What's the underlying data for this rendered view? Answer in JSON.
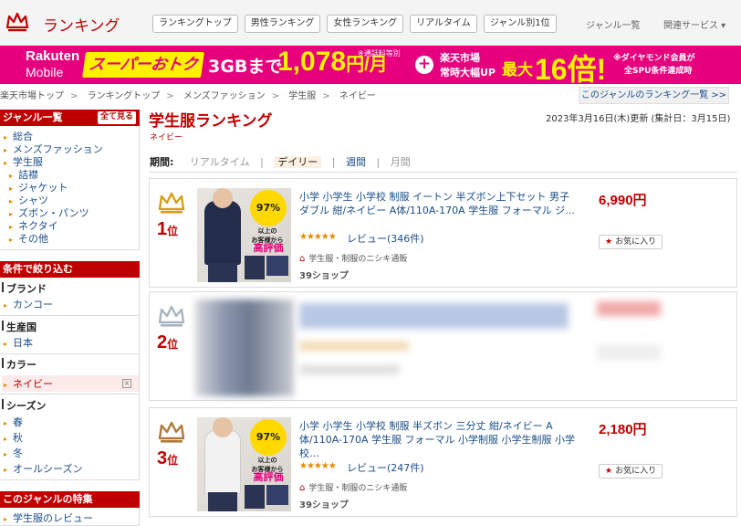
{
  "header": {
    "logo_text": "ランキング",
    "tabs": [
      "ランキングトップ",
      "男性ランキング",
      "女性ランキング",
      "リアルタイム",
      "ジャンル別1位"
    ],
    "genre_list_link": "ジャンル一覧",
    "related_services": "関連サービス ▾"
  },
  "banner": {
    "brand_top": "Rakuten",
    "brand_bottom": "Mobile",
    "sale": "スーパーおトク",
    "data_amount": "3GBまで",
    "note_call": "※通話料等別",
    "price": "1,078",
    "price_unit": "円/月",
    "ichiba_line1": "楽天市場",
    "ichiba_line2": "常時大幅UP",
    "max": "最大",
    "multiplier": "16倍!",
    "note_diamond": "※ダイヤモンド会員が",
    "note_spu": "全SPU条件達成時"
  },
  "breadcrumb": [
    "楽天市場トップ",
    "ランキングトップ",
    "メンズファッション",
    "学生服",
    "ネイビー"
  ],
  "genre_ranking_list_link": "このジャンルのランキング一覧 >>",
  "sidebar": {
    "genre_heading": "ジャンル一覧",
    "show_all": "全て見る",
    "genres": [
      "総合",
      "メンズファッション",
      "学生服",
      "詰襟",
      "ジャケット",
      "シャツ",
      "ズボン・パンツ",
      "ネクタイ",
      "その他"
    ],
    "filter_heading": "条件で絞り込む",
    "brand_label": "ブランド",
    "brand_value": "カンコー",
    "country_label": "生産国",
    "country_value": "日本",
    "color_label": "カラー",
    "color_value": "ネイビー",
    "season_label": "シーズン",
    "seasons": [
      "春",
      "秋",
      "冬",
      "オールシーズン"
    ],
    "feature_heading": "このジャンルの特集",
    "feature_item": "学生服のレビュー"
  },
  "main": {
    "title": "学生服ランキング",
    "subtitle": "ネイビー",
    "updated": "2023年3月16日(木)更新 (集計日：3月15日)",
    "period_label": "期間:",
    "periods": [
      "リアルタイム",
      "デイリー",
      "週間",
      "月間"
    ],
    "period_separators": [
      "|",
      "|",
      "|"
    ],
    "rank_suffix": "位"
  },
  "thumb_badge": {
    "pct": "97%",
    "line1": "以上の",
    "line2": "お客様から",
    "line3": "高評価"
  },
  "items": [
    {
      "rank": "1",
      "title": "小学 小学生 小学校 制服 イートン 半ズボン上下セット 男子 ダブル 紺/ネイビー A体/110A-170A 学生服 フォーマル ジ…",
      "stars": "★★★★★",
      "review": "レビュー(346件)",
      "shop_category": "学生服・制服のニシキ通販",
      "shop_name": "39ショップ",
      "price": "6,990円",
      "favorite": "お気に入り"
    },
    {
      "rank": "2"
    },
    {
      "rank": "3",
      "title": "小学 小学生 小学校 制服 半ズボン 三分丈 紺/ネイビー A体/110A-170A 学生服 フォーマル 小学制服 小学生制服 小学校…",
      "stars": "★★★★★",
      "review": "レビュー(247件)",
      "shop_category": "学生服・制服のニシキ通販",
      "shop_name": "39ショップ",
      "price": "2,180円",
      "favorite": "お気に入り"
    }
  ],
  "colors": {
    "brand_red": "#bf0000",
    "banner_pink": "#e6007e",
    "banner_yellow": "#fff200",
    "link_blue": "#1a4d8a",
    "gold_crown": "#d4a017",
    "silver_crown": "#a9b4c2",
    "bronze_crown": "#b07a3c"
  }
}
